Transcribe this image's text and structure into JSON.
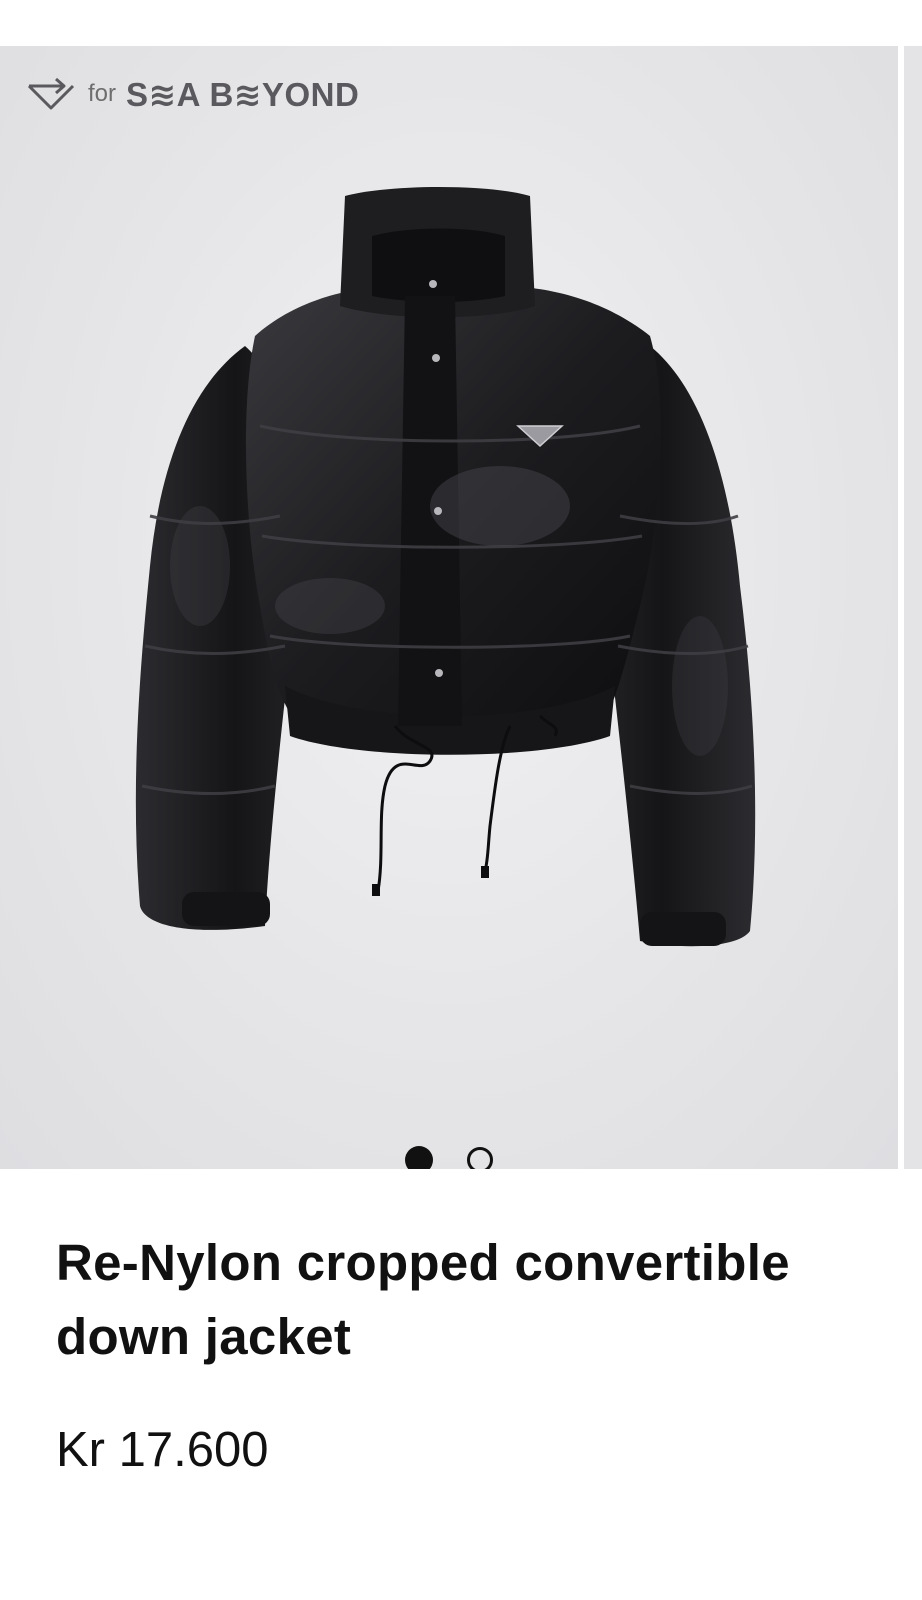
{
  "badge": {
    "prefix": "for",
    "brand": "S≋A B≋YOND",
    "icon": "sea-beyond-logo-icon"
  },
  "carousel": {
    "slide_count": 2,
    "active_index": 0,
    "image_alt": "Black cropped puffer down jacket"
  },
  "product": {
    "title": "Re-Nylon cropped convertible down jacket",
    "price": "Kr 17.600"
  },
  "colors": {
    "image_bg": "#e7e7e9",
    "text": "#111111",
    "jacket": "#1b1b1d"
  }
}
